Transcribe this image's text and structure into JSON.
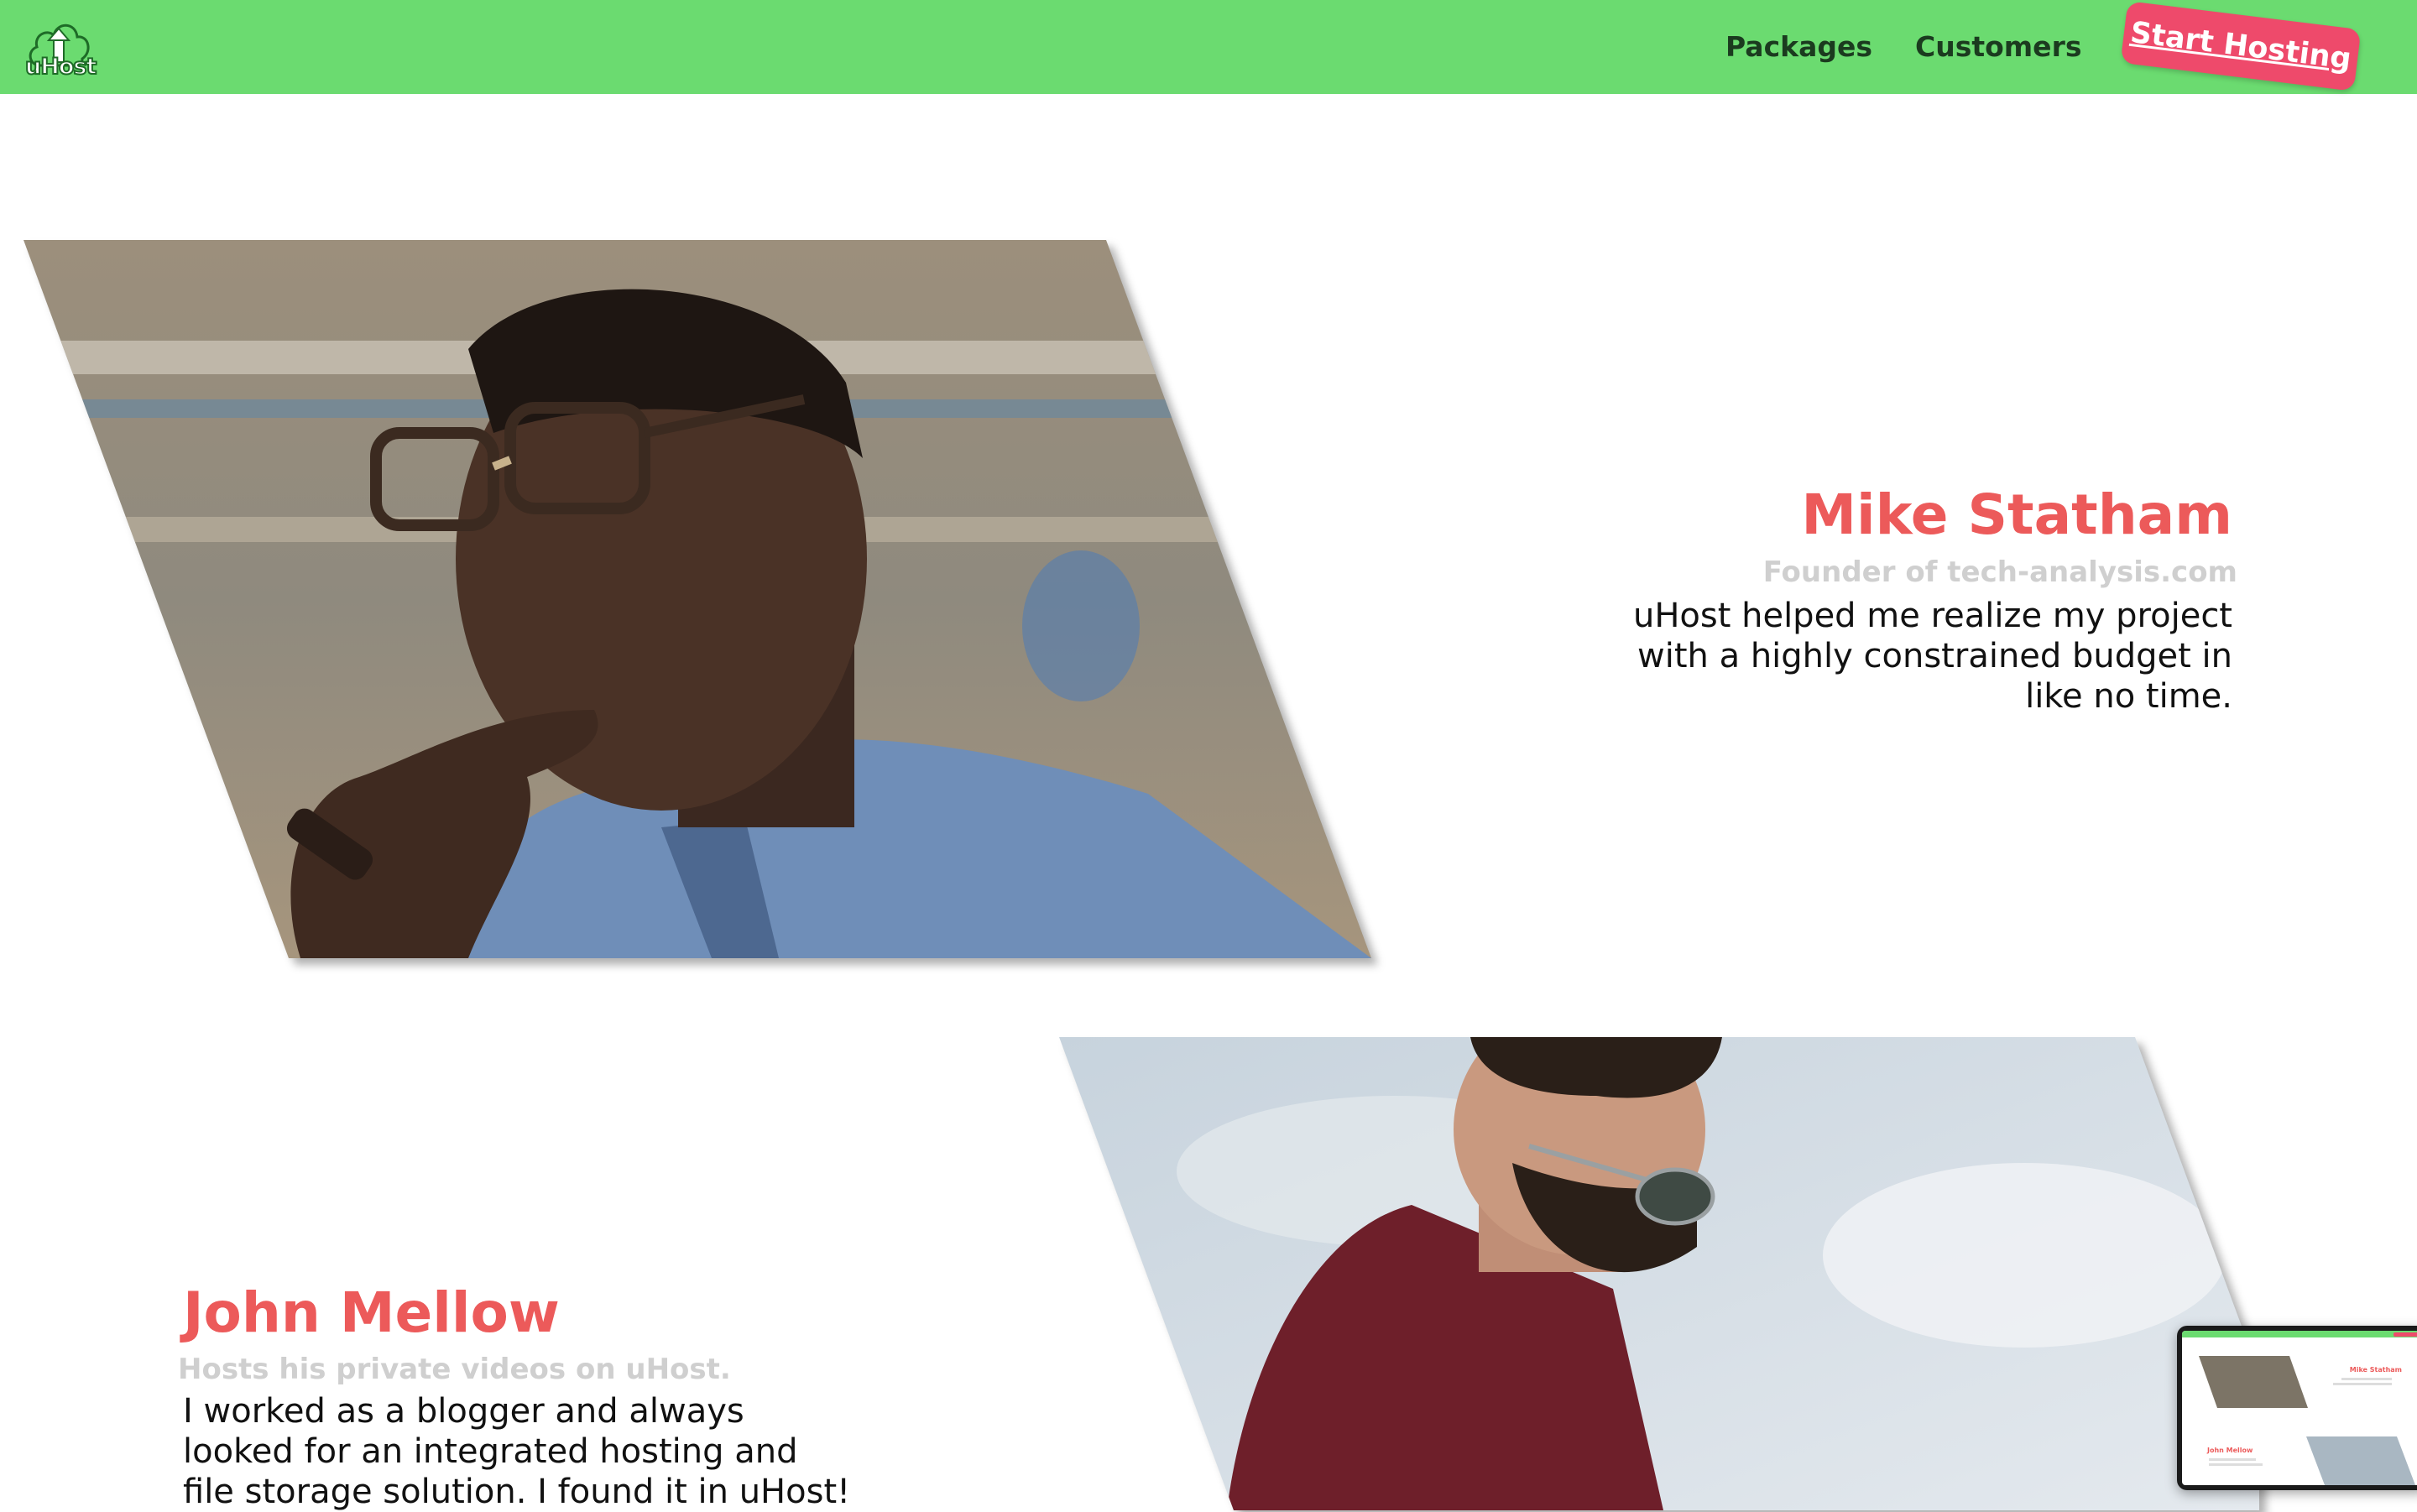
{
  "brand": {
    "name": "uHost",
    "logo_icon": "cloud-upload-icon",
    "colors": {
      "header_bg": "#6bdb70",
      "cta_bg": "#ee4a6b",
      "name_accent": "#ec5a5a",
      "subtitle_gray": "#cfcfcf"
    }
  },
  "nav": {
    "items": [
      {
        "label": "Packages"
      },
      {
        "label": "Customers"
      }
    ],
    "cta_label": "Start Hosting"
  },
  "testimonials": [
    {
      "name": "Mike Statham",
      "role": "Founder of tech-analysis.com",
      "quote_lines": [
        "uHost helped me realize my project",
        "with a highly constrained budget in",
        "like no time."
      ]
    },
    {
      "name": "John Mellow",
      "role": "Hosts his private videos on uHost.",
      "quote_lines": [
        "I worked as a blogger and always",
        "looked for an integrated hosting and",
        "file storage solution. I found it in uHost!"
      ]
    }
  ],
  "preview": {
    "label_1": "Mike Statham",
    "label_2": "John Mellow"
  }
}
